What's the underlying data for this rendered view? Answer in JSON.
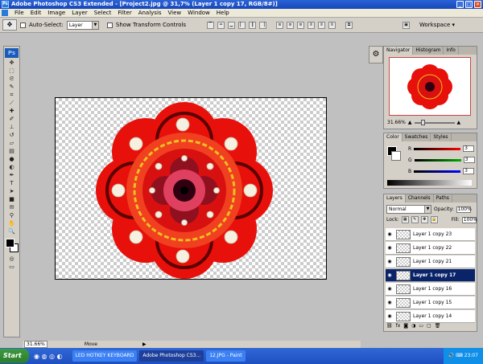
{
  "window": {
    "title": "Adobe Photoshop CS3 Extended - [Project2.jpg @ 31,7% (Layer 1 copy 17, RGB/8#)]",
    "min_label": "_",
    "max_label": "□",
    "close_label": "✕"
  },
  "menu": [
    "File",
    "Edit",
    "Image",
    "Layer",
    "Select",
    "Filter",
    "Analysis",
    "View",
    "Window",
    "Help"
  ],
  "options": {
    "auto_select_label": "Auto-Select:",
    "auto_select_value": "Layer",
    "transform_label": "Show Transform Controls",
    "workspace_label": "Workspace ▾"
  },
  "tools": {
    "logo": "Ps",
    "icons": [
      "move",
      "marquee",
      "lasso",
      "quick-select",
      "crop",
      "slice",
      "heal",
      "brush",
      "stamp",
      "history-brush",
      "eraser",
      "gradient",
      "blur",
      "dodge",
      "pen",
      "type",
      "path-select",
      "shape",
      "notes",
      "eyedropper",
      "hand",
      "zoom"
    ]
  },
  "status": {
    "zoom": "31.66%",
    "tool": "Move"
  },
  "navigator": {
    "tabs": [
      "Navigator",
      "Histogram",
      "Info"
    ],
    "zoom": "31.66%"
  },
  "color_panel": {
    "tabs": [
      "Color",
      "Swatches",
      "Styles"
    ],
    "channels": [
      {
        "label": "R",
        "value": "3",
        "color": "#ff0000"
      },
      {
        "label": "G",
        "value": "3",
        "color": "#00a000"
      },
      {
        "label": "B",
        "value": "3",
        "color": "#0000ff"
      }
    ]
  },
  "layers_panel": {
    "tabs": [
      "Layers",
      "Channels",
      "Paths"
    ],
    "blend_mode": "Normal",
    "opacity_label": "Opacity:",
    "opacity_value": "100%",
    "lock_label": "Lock:",
    "fill_label": "Fill:",
    "fill_value": "100%",
    "layers": [
      {
        "name": "Layer 1 copy 23",
        "selected": false
      },
      {
        "name": "Layer 1 copy 22",
        "selected": false
      },
      {
        "name": "Layer 1 copy 21",
        "selected": false
      },
      {
        "name": "Layer 1 copy 17",
        "selected": true
      },
      {
        "name": "Layer 1 copy 16",
        "selected": false
      },
      {
        "name": "Layer 1 copy 15",
        "selected": false
      },
      {
        "name": "Layer 1 copy 14",
        "selected": false
      }
    ]
  },
  "taskbar": {
    "start": "Start",
    "tasks": [
      {
        "label": "LED HOTKEY KEYBOARD",
        "active": false
      },
      {
        "label": "Adobe Photoshop CS3...",
        "active": true
      },
      {
        "label": "12.JPG - Paint",
        "active": false
      }
    ],
    "clock": "23:07"
  },
  "colors": {
    "flower_outer": "#e8100a",
    "flower_dark": "#5a0000",
    "flower_accent": "#f0c020",
    "selection": "#0a246a"
  }
}
